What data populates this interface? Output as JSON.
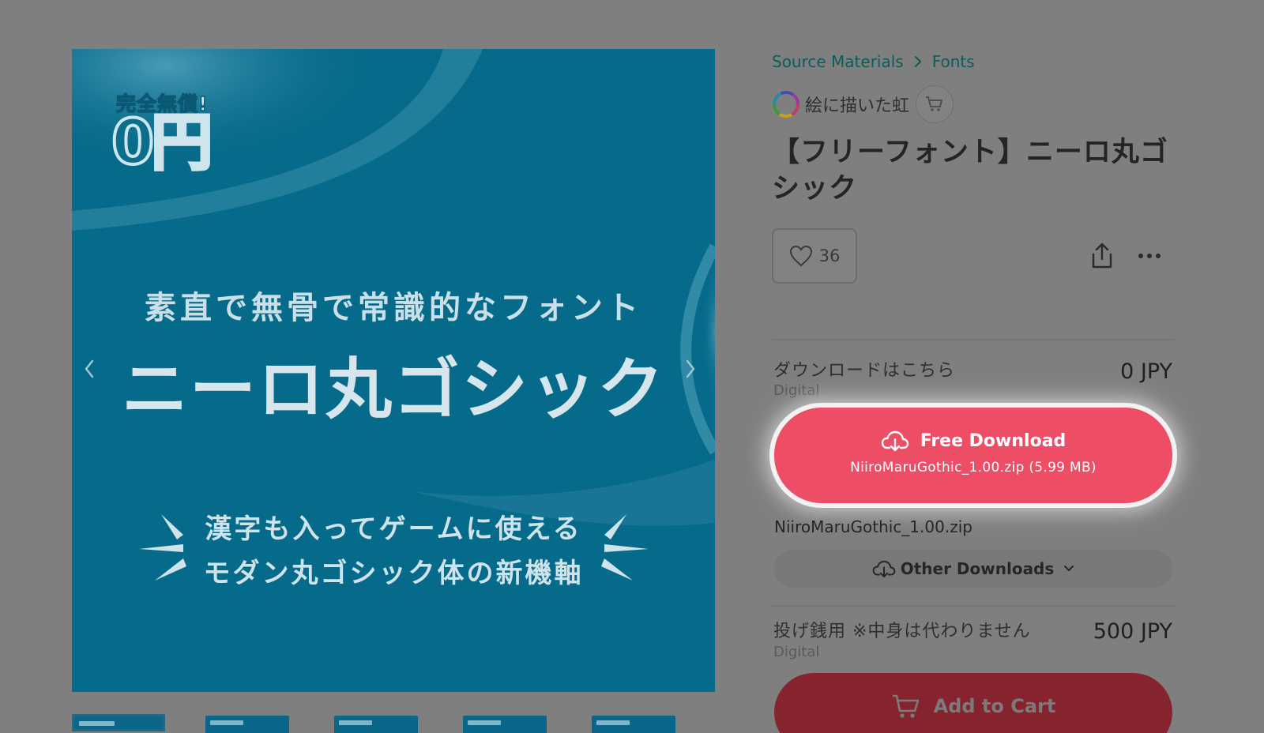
{
  "hero": {
    "badge_top": "完全無償!",
    "badge_big": "0円",
    "subtitle": "素直で無骨で常識的なフォント",
    "title": "ニーロ丸ゴシック",
    "line1": "漢字も入ってゲームに使える",
    "line2": "モダン丸ゴシック体の新機軸",
    "prev_icon": "chevron-left-icon",
    "next_icon": "chevron-right-icon",
    "thumbnail_count": 5
  },
  "breadcrumb": {
    "items": [
      "Source Materials",
      "Fonts"
    ]
  },
  "shop": {
    "name": "絵に描いた虹"
  },
  "product": {
    "title": "【フリーフォント】ニーロ丸ゴシック",
    "likes": "36"
  },
  "items": [
    {
      "name": "ダウンロードはこちら",
      "type": "Digital",
      "price": "0 JPY",
      "button_label": "Free Download",
      "button_file": "NiiroMaruGothic_1.00.zip (5.99 MB)",
      "filename": "NiiroMaruGothic_1.00.zip",
      "other_label": "Other Downloads"
    },
    {
      "name": "投げ銭用 ※中身は代わりません",
      "type": "Digital",
      "price": "500 JPY",
      "button_label": "Add to Cart"
    }
  ],
  "colors": {
    "overlay": "#7f7f7f",
    "accent": "#ee4d66",
    "link": "#0c5c57",
    "hero_bg": "#066a8a"
  }
}
